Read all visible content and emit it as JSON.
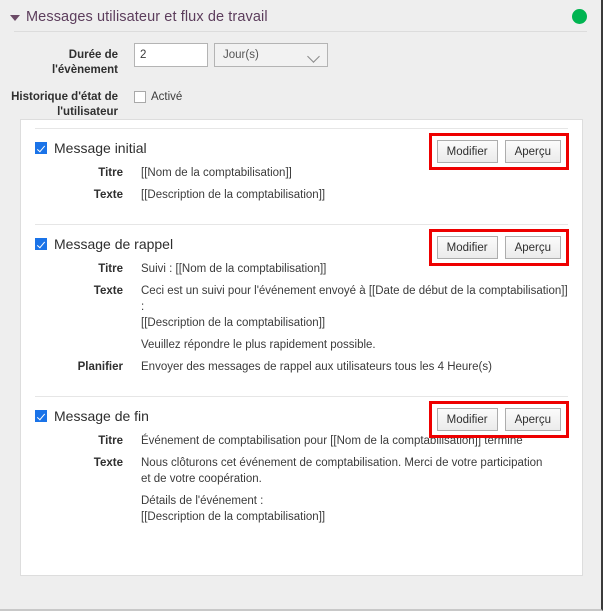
{
  "header": {
    "title": "Messages utilisateur et flux de travail",
    "twisty_icon": "triangle-down-icon",
    "status_icon": "status-dot-green",
    "status_color": "#00b451"
  },
  "form": {
    "duration": {
      "label": "Durée de l'évènement",
      "value": "2",
      "unit_selected": "Jour(s)",
      "chevron_icon": "chevron-down-icon"
    },
    "history": {
      "label": "Historique d'état de l'utilisateur",
      "checkbox_label": "Activé",
      "checked": false
    }
  },
  "buttons": {
    "edit": "Modifier",
    "preview": "Aperçu",
    "highlight_color": "#ee0000"
  },
  "labels": {
    "titre": "Titre",
    "texte": "Texte",
    "planifier": "Planifier"
  },
  "messages": [
    {
      "title": "Message initial",
      "checked": true,
      "titre": "[[Nom de la comptabilisation]]",
      "texte": "[[Description de la comptabilisation]]"
    },
    {
      "title": "Message de rappel",
      "checked": true,
      "titre": "Suivi : [[Nom de la comptabilisation]]",
      "texte": "Ceci est un suivi pour l'événement envoyé à [[Date de début de la comptabilisation]] :\n[[Description de la comptabilisation]]",
      "texte_extra": "Veuillez répondre le plus rapidement possible.",
      "planifier": "Envoyer des messages de rappel aux utilisateurs tous les 4 Heure(s)"
    },
    {
      "title": "Message de fin",
      "checked": true,
      "titre": "Événement de comptabilisation pour [[Nom de la comptabilisation]] terminé",
      "texte": "Nous clôturons cet événement de comptabilisation. Merci de votre participation\n et de votre  coopération.",
      "texte_extra": "Détails de l'événement :\n[[Description de la comptabilisation]]"
    }
  ]
}
